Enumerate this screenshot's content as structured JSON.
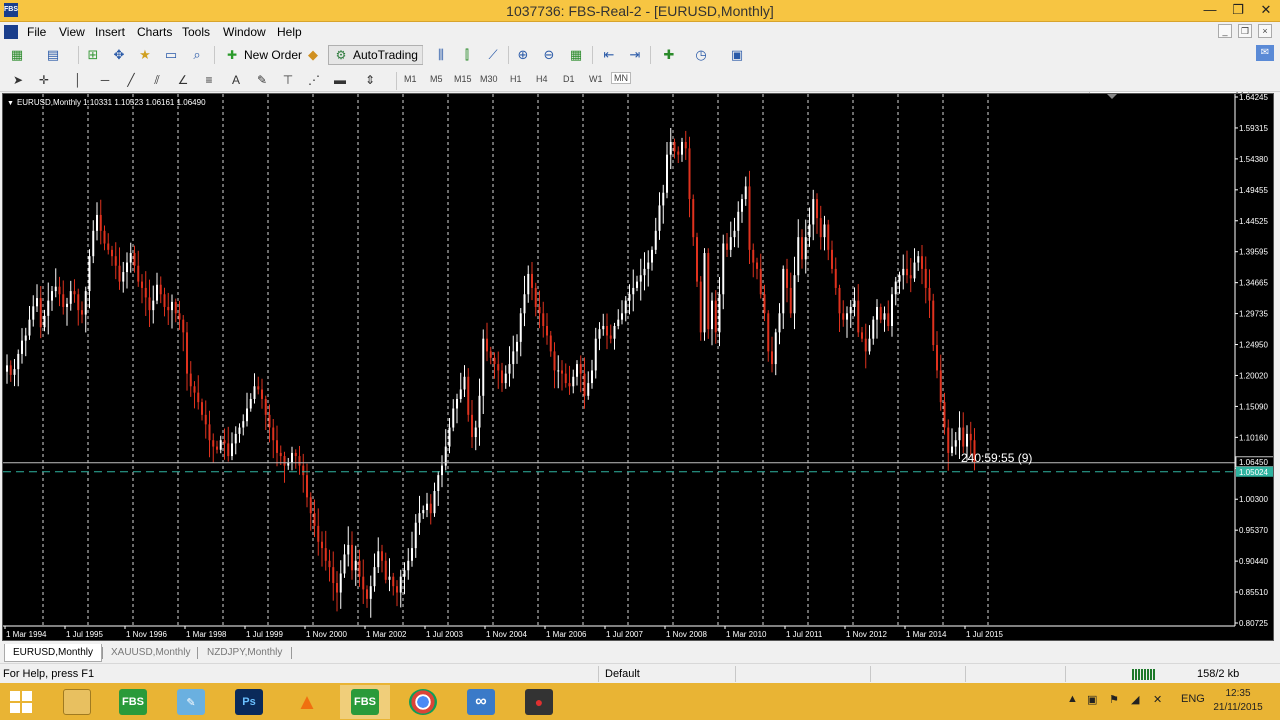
{
  "window": {
    "title": "1037736: FBS-Real-2 - [EURUSD,Monthly]",
    "app_logo": "FBS",
    "minimize": "—",
    "restore": "❐",
    "close": "✕"
  },
  "menu": {
    "items": [
      "File",
      "View",
      "Insert",
      "Charts",
      "Tools",
      "Window",
      "Help"
    ],
    "mdi_minimize": "_",
    "mdi_restore": "❐",
    "mdi_close": "×"
  },
  "toolbar": {
    "new_order_label": "New Order",
    "autotrading_label": "AutoTrading",
    "search_placeholder": "",
    "timeframes": [
      "M1",
      "M5",
      "M15",
      "M30",
      "H1",
      "H4",
      "D1",
      "W1",
      "MN"
    ],
    "active_timeframe": "MN"
  },
  "chart": {
    "symbol_info": "EURUSD,Monthly  1.10331 1.10523 1.06161 1.06490",
    "countdown": "240:59:55 (9)",
    "bid_price_label": "1.06450",
    "ask_price_label": "1.05024",
    "bid_price": 1.0645,
    "ask_price": 1.05024,
    "price_ticks": [
      "1.64245",
      "1.59315",
      "1.54380",
      "1.49455",
      "1.44525",
      "1.39595",
      "1.34665",
      "1.29735",
      "1.24950",
      "1.20020",
      "1.15090",
      "1.10160",
      "1.05230",
      "1.00300",
      "0.95370",
      "0.90440",
      "0.85510",
      "0.80725"
    ],
    "date_ticks": [
      "1 Mar 1994",
      "1 Jul 1995",
      "1 Nov 1996",
      "1 Mar 1998",
      "1 Jul 1999",
      "1 Nov 2000",
      "1 Mar 2002",
      "1 Jul 2003",
      "1 Nov 2004",
      "1 Mar 2006",
      "1 Jul 2007",
      "1 Nov 2008",
      "1 Mar 2010",
      "1 Jul 2011",
      "1 Nov 2012",
      "1 Mar 2014",
      "1 Jul 2015"
    ],
    "price_range": [
      0.80725,
      1.64245
    ],
    "colors": {
      "background": "#000000",
      "bull": "#ffffff",
      "bear": "#e0321e",
      "grid": "#ffffff",
      "bid_line": "#c0c0c0",
      "ask_line": "#2fb3a0",
      "label_bg": "#2fb3a0"
    },
    "monthly_closes": [
      1.218,
      1.203,
      1.212,
      1.236,
      1.257,
      1.265,
      1.29,
      1.311,
      1.324,
      1.278,
      1.296,
      1.32,
      1.335,
      1.342,
      1.33,
      1.31,
      1.315,
      1.335,
      1.33,
      1.305,
      1.298,
      1.335,
      1.39,
      1.43,
      1.455,
      1.43,
      1.41,
      1.4,
      1.39,
      1.375,
      1.35,
      1.365,
      1.38,
      1.395,
      1.375,
      1.35,
      1.34,
      1.325,
      1.305,
      1.32,
      1.345,
      1.33,
      1.31,
      1.305,
      1.318,
      1.3,
      1.29,
      1.27,
      1.205,
      1.185,
      1.175,
      1.16,
      1.14,
      1.125,
      1.1,
      1.09,
      1.085,
      1.1,
      1.095,
      1.075,
      1.095,
      1.11,
      1.12,
      1.13,
      1.15,
      1.165,
      1.185,
      1.18,
      1.165,
      1.14,
      1.12,
      1.1,
      1.08,
      1.075,
      1.06,
      1.065,
      1.08,
      1.075,
      1.06,
      1.045,
      1.01,
      0.985,
      0.965,
      0.94,
      0.93,
      0.91,
      0.9,
      0.875,
      0.86,
      0.89,
      0.92,
      0.935,
      0.895,
      0.91,
      0.885,
      0.865,
      0.85,
      0.87,
      0.9,
      0.925,
      0.91,
      0.88,
      0.885,
      0.87,
      0.86,
      0.885,
      0.895,
      0.91,
      0.93,
      0.97,
      0.985,
      0.99,
      1.0,
      0.985,
      1.02,
      1.045,
      1.06,
      1.09,
      1.12,
      1.15,
      1.165,
      1.18,
      1.2,
      1.14,
      1.105,
      1.12,
      1.17,
      1.26,
      1.24,
      1.23,
      1.22,
      1.21,
      1.19,
      1.205,
      1.22,
      1.24,
      1.255,
      1.3,
      1.33,
      1.362,
      1.34,
      1.31,
      1.3,
      1.28,
      1.265,
      1.24,
      1.21,
      1.21,
      1.205,
      1.19,
      1.185,
      1.2,
      1.22,
      1.205,
      1.17,
      1.19,
      1.21,
      1.26,
      1.275,
      1.28,
      1.265,
      1.26,
      1.28,
      1.29,
      1.3,
      1.32,
      1.33,
      1.34,
      1.35,
      1.36,
      1.37,
      1.38,
      1.4,
      1.43,
      1.47,
      1.49,
      1.55,
      1.57,
      1.555,
      1.55,
      1.57,
      1.56,
      1.48,
      1.42,
      1.35,
      1.27,
      1.395,
      1.275,
      1.32,
      1.27,
      1.33,
      1.41,
      1.4,
      1.42,
      1.43,
      1.46,
      1.48,
      1.5,
      1.4,
      1.38,
      1.37,
      1.33,
      1.3,
      1.24,
      1.22,
      1.27,
      1.3,
      1.37,
      1.34,
      1.3,
      1.36,
      1.42,
      1.385,
      1.42,
      1.44,
      1.48,
      1.45,
      1.42,
      1.44,
      1.4,
      1.37,
      1.34,
      1.3,
      1.29,
      1.3,
      1.31,
      1.32,
      1.27,
      1.26,
      1.24,
      1.26,
      1.29,
      1.31,
      1.29,
      1.3,
      1.28,
      1.33,
      1.35,
      1.36,
      1.37,
      1.36,
      1.355,
      1.38,
      1.39,
      1.37,
      1.34,
      1.32,
      1.25,
      1.21,
      1.16,
      1.12,
      1.08,
      1.09,
      1.1,
      1.12,
      1.09,
      1.11,
      1.1,
      1.0649
    ]
  },
  "tabs": [
    "EURUSD,Monthly",
    "XAUUSD,Monthly",
    "NZDJPY,Monthly"
  ],
  "status": {
    "help": "For Help, press F1",
    "profile": "Default",
    "traffic": "158/2 kb"
  },
  "taskbar": {
    "apps": [
      "File Explorer",
      "FBS",
      "Notepad",
      "Ps",
      "VLC",
      "FBS",
      "Chrome",
      "Infinity",
      "Recorder"
    ],
    "language": "ENG",
    "time": "12:35",
    "date": "21/11/2015"
  }
}
